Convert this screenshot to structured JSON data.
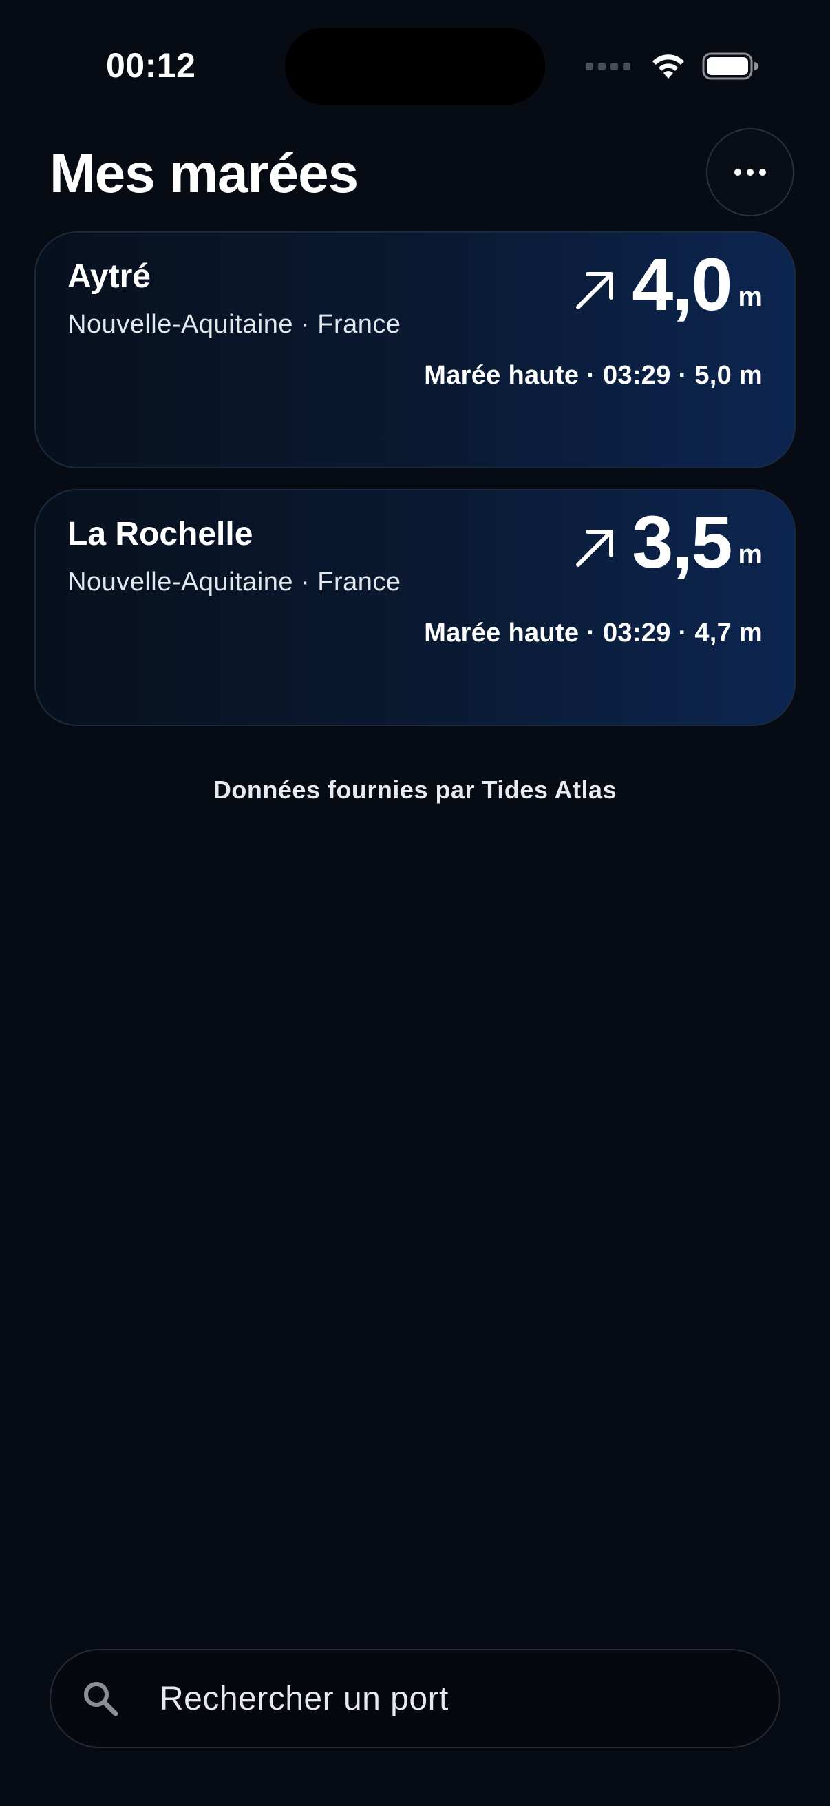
{
  "status_bar": {
    "time": "00:12"
  },
  "header": {
    "title": "Mes marées",
    "more_icon": "ellipsis-icon"
  },
  "cards": [
    {
      "name": "Aytré",
      "region": "Nouvelle-Aquitaine · France",
      "trend_icon": "arrow-up-right-icon",
      "height": "4,0",
      "unit": "m",
      "next_tide": "Marée haute · 03:29 · 5,0 m"
    },
    {
      "name": "La Rochelle",
      "region": "Nouvelle-Aquitaine · France",
      "trend_icon": "arrow-up-right-icon",
      "height": "3,5",
      "unit": "m",
      "next_tide": "Marée haute · 03:29 · 4,7 m"
    }
  ],
  "attribution": "Données fournies par Tides Atlas",
  "search": {
    "placeholder": "Rechercher un port",
    "icon": "search-icon"
  },
  "colors": {
    "background": "#060b14",
    "card_gradient_end": "#0c2550",
    "text": "#ffffff"
  }
}
